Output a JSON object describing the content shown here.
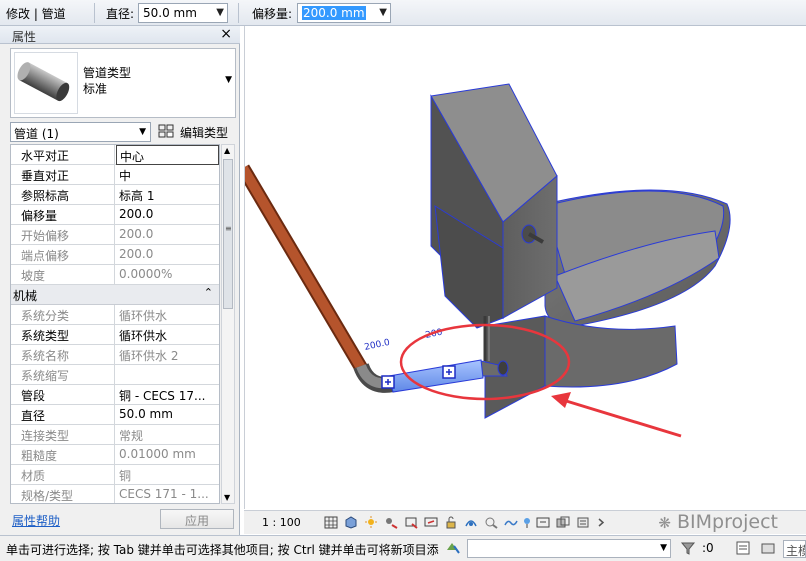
{
  "optionbar": {
    "context": "修改 | 管道",
    "diameter_label": "直径:",
    "diameter_value": "50.0 mm",
    "offset_label": "偏移量:",
    "offset_value": "200.0 mm"
  },
  "properties": {
    "title": "属性",
    "type_family": "管道类型",
    "type_name": "标准",
    "instance_selector": "管道 (1)",
    "edit_type_label": "编辑类型",
    "rows": [
      {
        "name": "水平对正",
        "value": "中心"
      },
      {
        "name": "垂直对正",
        "value": "中"
      },
      {
        "name": "参照标高",
        "value": "标高 1"
      },
      {
        "name": "偏移量",
        "value": "200.0"
      },
      {
        "name": "开始偏移",
        "value": "200.0"
      },
      {
        "name": "端点偏移",
        "value": "200.0"
      },
      {
        "name": "坡度",
        "value": "0.0000%"
      }
    ],
    "group_mechanical": "机械",
    "group_collapse_glyph": "⌃",
    "mech_rows": [
      {
        "name": "系统分类",
        "value": "循环供水"
      },
      {
        "name": "系统类型",
        "value": "循环供水"
      },
      {
        "name": "系统名称",
        "value": "循环供水 2"
      },
      {
        "name": "系统缩写",
        "value": ""
      },
      {
        "name": "管段",
        "value": "铜 - CECS 17..."
      },
      {
        "name": "直径",
        "value": "50.0 mm"
      },
      {
        "name": "连接类型",
        "value": "常规"
      },
      {
        "name": "粗糙度",
        "value": "0.01000 mm"
      },
      {
        "name": "材质",
        "value": "铜"
      },
      {
        "name": "规格/类型",
        "value": "CECS 171 - 1..."
      }
    ],
    "help_link": "属性帮助",
    "apply_button": "应用"
  },
  "viewport": {
    "dimension_left": "200.0",
    "dimension_right": "200"
  },
  "viewbar": {
    "scale": "1 : 100",
    "watermark": "BIMproject"
  },
  "status": {
    "hint": "单击可进行选择; 按 Tab 键并单击可选择其他项目; 按 Ctrl 键并单击可将新项目添",
    "filter_count": ":0",
    "tail": "主模"
  },
  "colors": {
    "pipe_selected": "#7fa6f2",
    "pipe_other": "#b5542c",
    "highlight": "#e8363d",
    "model": "#707070",
    "selection_edge": "#2a3bd8"
  }
}
